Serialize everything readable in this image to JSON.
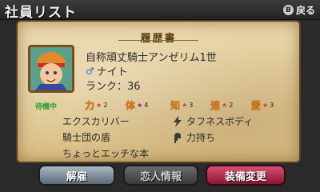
{
  "header": {
    "title": "社員リスト",
    "back_key": "B",
    "back_label": "戻る"
  },
  "card": {
    "heading": "履歴書",
    "status": "待機中",
    "name": "自称頑丈騎士アンゼリム1世",
    "job": "ナイト",
    "rank": "ランク：36"
  },
  "stats": [
    {
      "label": "力",
      "value": "2",
      "star_color": "#d43a2a"
    },
    {
      "label": "体",
      "value": "4",
      "star_color": "#7a2a8a"
    },
    {
      "label": "知",
      "value": "3",
      "star_color": "#d43a2a"
    },
    {
      "label": "速",
      "value": "2",
      "star_color": "#d43a2a"
    },
    {
      "label": "愛",
      "value": "3",
      "star_color": "#d43a2a"
    }
  ],
  "equipment": [
    "エクスカリバー",
    "騎士団の盾",
    "ちょっとエッチな本"
  ],
  "skills": [
    {
      "icon": "lightning-icon",
      "label": "タフネスボディ"
    },
    {
      "icon": "power-icon",
      "label": "力持ち"
    }
  ],
  "buttons": {
    "dismiss": "解雇",
    "lover": "恋人情報",
    "equip": "装備変更"
  },
  "colors": {
    "parchment": "#e3cc97",
    "stat_label": "#d8771a",
    "equip_button": "#c2375c"
  }
}
